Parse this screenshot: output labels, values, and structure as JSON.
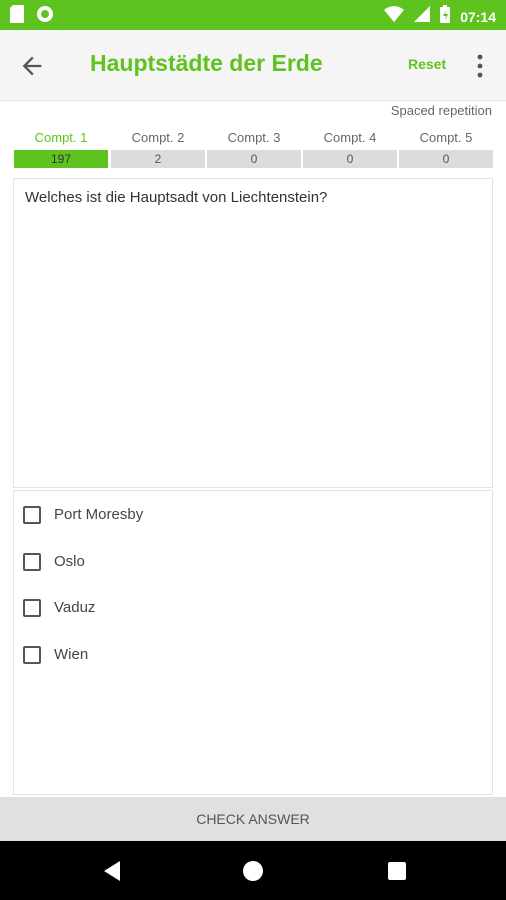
{
  "status_bar": {
    "time": "07:14",
    "left_icons": [
      "sd-card-icon",
      "sync-icon"
    ],
    "right_icons": [
      "wifi-icon",
      "signal-icon",
      "battery-icon"
    ]
  },
  "app_bar": {
    "back_icon": "arrow-back-icon",
    "title": "Hauptstädte der Erde",
    "reset_label": "Reset",
    "overflow_icon": "more-vert-icon"
  },
  "mode_label": "Spaced repetition",
  "compartments": [
    {
      "label": "Compt. 1",
      "count": "197",
      "active": true
    },
    {
      "label": "Compt. 2",
      "count": "2",
      "active": false
    },
    {
      "label": "Compt. 3",
      "count": "0",
      "active": false
    },
    {
      "label": "Compt. 4",
      "count": "0",
      "active": false
    },
    {
      "label": "Compt. 5",
      "count": "0",
      "active": false
    }
  ],
  "question": "Welches ist die Hauptsadt von Liechtenstein?",
  "answers": [
    {
      "text": "Port Moresby",
      "checked": false
    },
    {
      "text": "Oslo",
      "checked": false
    },
    {
      "text": "Vaduz",
      "checked": false
    },
    {
      "text": "Wien",
      "checked": false
    }
  ],
  "check_button": "CHECK ANSWER",
  "colors": {
    "accent": "#5fc31f",
    "inactive_bar": "#dcdcdc"
  }
}
